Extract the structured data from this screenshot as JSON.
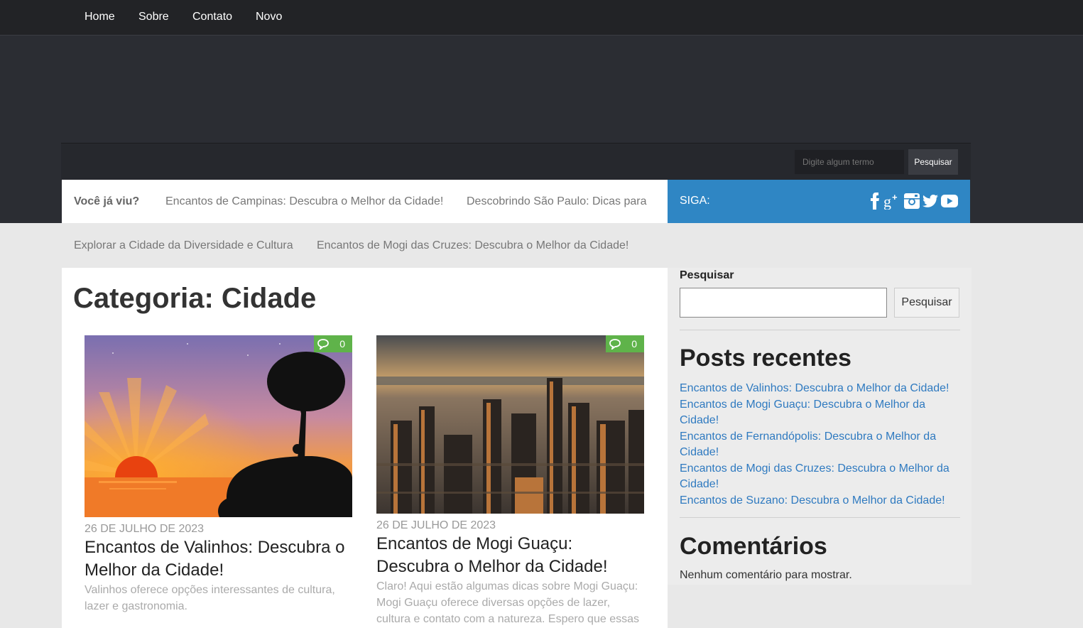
{
  "nav": {
    "items": [
      "Home",
      "Sobre",
      "Contato",
      "Novo"
    ]
  },
  "header_search": {
    "placeholder": "Digite algum termo",
    "button": "Pesquisar"
  },
  "ticker": {
    "label": "Você já viu?",
    "items": [
      "Encantos de Campinas: Descubra o Melhor da Cidade!",
      "Descobrindo São Paulo: Dicas para",
      "Explorar a Cidade da Diversidade e Cultura",
      "Encantos de Mogi das Cruzes: Descubra o Melhor da Cidade!"
    ]
  },
  "follow": {
    "label": "SIGA:",
    "icons": [
      "facebook-icon",
      "google-plus-icon",
      "instagram-icon",
      "twitter-icon",
      "youtube-icon"
    ]
  },
  "page": {
    "title": "Categoria: Cidade"
  },
  "posts": [
    {
      "comments": "0",
      "date": "26 DE JULHO DE 2023",
      "title": "Encantos de Valinhos: Descubra o Melhor da Cidade!",
      "excerpt": "Valinhos oferece opções interessantes de cultura, lazer e gastronomia."
    },
    {
      "comments": "0",
      "date": "26 DE JULHO DE 2023",
      "title": "Encantos de Mogi Guaçu: Descubra o Melhor da Cidade!",
      "excerpt": "Claro! Aqui estão algumas dicas sobre Mogi Guaçu: Mogi Guaçu oferece diversas opções de lazer, cultura e contato com a natureza. Espero que essas dicas te"
    }
  ],
  "sidebar": {
    "search_label": "Pesquisar",
    "search_button": "Pesquisar",
    "recent_title": "Posts recentes",
    "recent_posts": [
      "Encantos de Valinhos: Descubra o Melhor da Cidade!",
      "Encantos de Mogi Guaçu: Descubra o Melhor da Cidade!",
      "Encantos de Fernandópolis: Descubra o Melhor da Cidade!",
      "Encantos de Mogi das Cruzes: Descubra o Melhor da Cidade!",
      "Encantos de Suzano: Descubra o Melhor da Cidade!"
    ],
    "comments_title": "Comentários",
    "no_comments": "Nenhum comentário para mostrar."
  },
  "colors": {
    "accent": "#2f86c4",
    "badge": "#5fb34a",
    "link": "#2f7ac0"
  }
}
